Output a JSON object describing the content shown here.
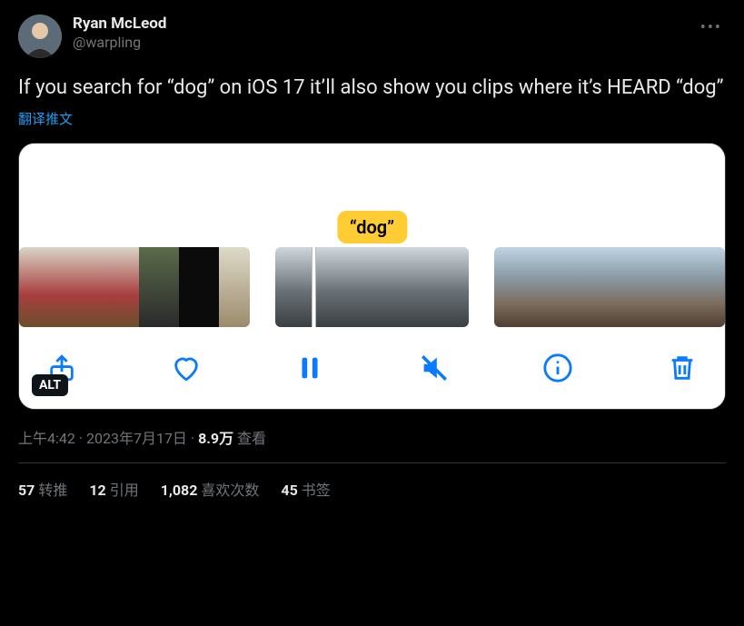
{
  "author": {
    "display_name": "Ryan McLeod",
    "handle": "@warpling"
  },
  "body": "If you search for “dog” on iOS 17 it’ll also show you clips where it’s HEARD “dog”",
  "translate_label": "翻译推文",
  "media": {
    "caption": "“dog”",
    "alt_badge": "ALT",
    "toolbar_icons": [
      "share-icon",
      "heart-icon",
      "pause-icon",
      "mute-icon",
      "info-icon",
      "trash-icon"
    ]
  },
  "meta": {
    "time": "上午4:42",
    "sep": " · ",
    "date": "2023年7月17日",
    "views_count": "8.9万",
    "views_label": " 查看"
  },
  "stats": {
    "retweets": {
      "count": "57",
      "label": "转推"
    },
    "quotes": {
      "count": "12",
      "label": "引用"
    },
    "likes": {
      "count": "1,082",
      "label": "喜欢次数"
    },
    "bookmarks": {
      "count": "45",
      "label": "书签"
    }
  }
}
